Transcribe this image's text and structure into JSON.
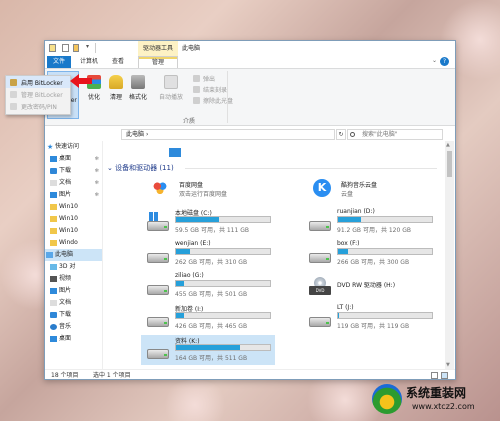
{
  "window": {
    "title": "此电脑",
    "contextual_tab_header": "驱动器工具"
  },
  "ribbon": {
    "tabs": [
      {
        "label": "文件"
      },
      {
        "label": "计算机"
      },
      {
        "label": "查看"
      },
      {
        "label": "管理"
      }
    ],
    "bitlocker": {
      "label": "BitLocker"
    },
    "buttons": [
      {
        "label": "优化",
        "icon": "optimize-icon"
      },
      {
        "label": "清理",
        "icon": "cleanup-icon"
      },
      {
        "label": "格式化",
        "icon": "format-icon"
      },
      {
        "label": "自动播放",
        "icon": "autoplay-icon"
      }
    ],
    "small_commands": [
      {
        "label": "弹出",
        "icon": "eject-icon"
      },
      {
        "label": "结束刻录",
        "icon": "finish-burn-icon"
      },
      {
        "label": "擦除此光盘",
        "icon": "erase-disc-icon"
      }
    ],
    "group_label": "介质"
  },
  "bitlocker_menu": {
    "items": [
      {
        "label": "启用 BitLocker",
        "state": "highlighted"
      },
      {
        "label": "管理 BitLocker",
        "state": "disabled"
      },
      {
        "label": "更改密码/PIN",
        "state": "disabled"
      }
    ]
  },
  "address_bar": {
    "path": "此电脑",
    "separator": "›",
    "search_placeholder": "搜索\"此电脑\""
  },
  "nav_pane": {
    "items": [
      {
        "label": "快速访问",
        "icon": "star-icon",
        "pinned": false
      },
      {
        "label": "桌面",
        "icon": "desktop-icon",
        "pinned": true
      },
      {
        "label": "下载",
        "icon": "download-icon",
        "pinned": true
      },
      {
        "label": "文档",
        "icon": "documents-icon",
        "pinned": true
      },
      {
        "label": "图片",
        "icon": "pictures-icon",
        "pinned": true
      },
      {
        "label": "Win10",
        "icon": "folder-icon",
        "pinned": false
      },
      {
        "label": "Win10",
        "icon": "folder-icon",
        "pinned": false
      },
      {
        "label": "Win10",
        "icon": "folder-icon",
        "pinned": false
      },
      {
        "label": "Windo",
        "icon": "folder-icon",
        "pinned": false
      },
      {
        "label": "此电脑",
        "icon": "this-pc-icon",
        "pinned": false
      },
      {
        "label": "3D 对",
        "icon": "3d-objects-icon",
        "pinned": false
      },
      {
        "label": "视频",
        "icon": "videos-icon",
        "pinned": false
      },
      {
        "label": "图片",
        "icon": "pictures-icon",
        "pinned": false
      },
      {
        "label": "文档",
        "icon": "documents-icon",
        "pinned": false
      },
      {
        "label": "下载",
        "icon": "download-icon",
        "pinned": false
      },
      {
        "label": "音乐",
        "icon": "music-icon",
        "pinned": false
      },
      {
        "label": "桌面",
        "icon": "desktop-icon",
        "pinned": false
      }
    ],
    "pin_glyph": "✻"
  },
  "content": {
    "section_header": "设备和驱动器 (11)",
    "apps": [
      {
        "name": "百度网盘",
        "subtitle": "双击运行百度网盘",
        "icon": "baidu-netdisk-icon"
      },
      {
        "name": "酷狗音乐云盘",
        "subtitle": "云盘",
        "icon": "kugou-icon"
      }
    ],
    "drives": [
      {
        "name": "本地磁盘 (C:)",
        "free": "59.5 GB 可用，共 111 GB",
        "used": 0.46,
        "type": "system"
      },
      {
        "name": "ruanjian (D:)",
        "free": "91.2 GB 可用，共 120 GB",
        "used": 0.24,
        "type": "disk"
      },
      {
        "name": "wenjian (E:)",
        "free": "262 GB 可用，共 310 GB",
        "used": 0.15,
        "type": "disk"
      },
      {
        "name": "box (F:)",
        "free": "266 GB 可用，共 300 GB",
        "used": 0.11,
        "type": "disk"
      },
      {
        "name": "ziliao (G:)",
        "free": "455 GB 可用，共 501 GB",
        "used": 0.09,
        "type": "disk"
      },
      {
        "name": "DVD RW 驱动器 (H:)",
        "free": "",
        "used": null,
        "type": "dvd"
      },
      {
        "name": "新加卷 (I:)",
        "free": "426 GB 可用，共 465 GB",
        "used": 0.08,
        "type": "disk"
      },
      {
        "name": "LT (J:)",
        "free": "119 GB 可用，共 119 GB",
        "used": 0.01,
        "type": "disk"
      },
      {
        "name": "资料 (K:)",
        "free": "164 GB 可用，共 511 GB",
        "used": 0.68,
        "type": "disk",
        "selected": true
      }
    ]
  },
  "status_bar": {
    "count": "18 个项目",
    "selected": "选中 1 个项目"
  },
  "watermark": {
    "title": "系统重装网",
    "url": "www.xtcz2.com"
  },
  "colors": {
    "accent": "#1979ca",
    "drive_bar": "#26a0da",
    "selection": "#cce4f7",
    "context_tab": "#fdf2c5"
  }
}
